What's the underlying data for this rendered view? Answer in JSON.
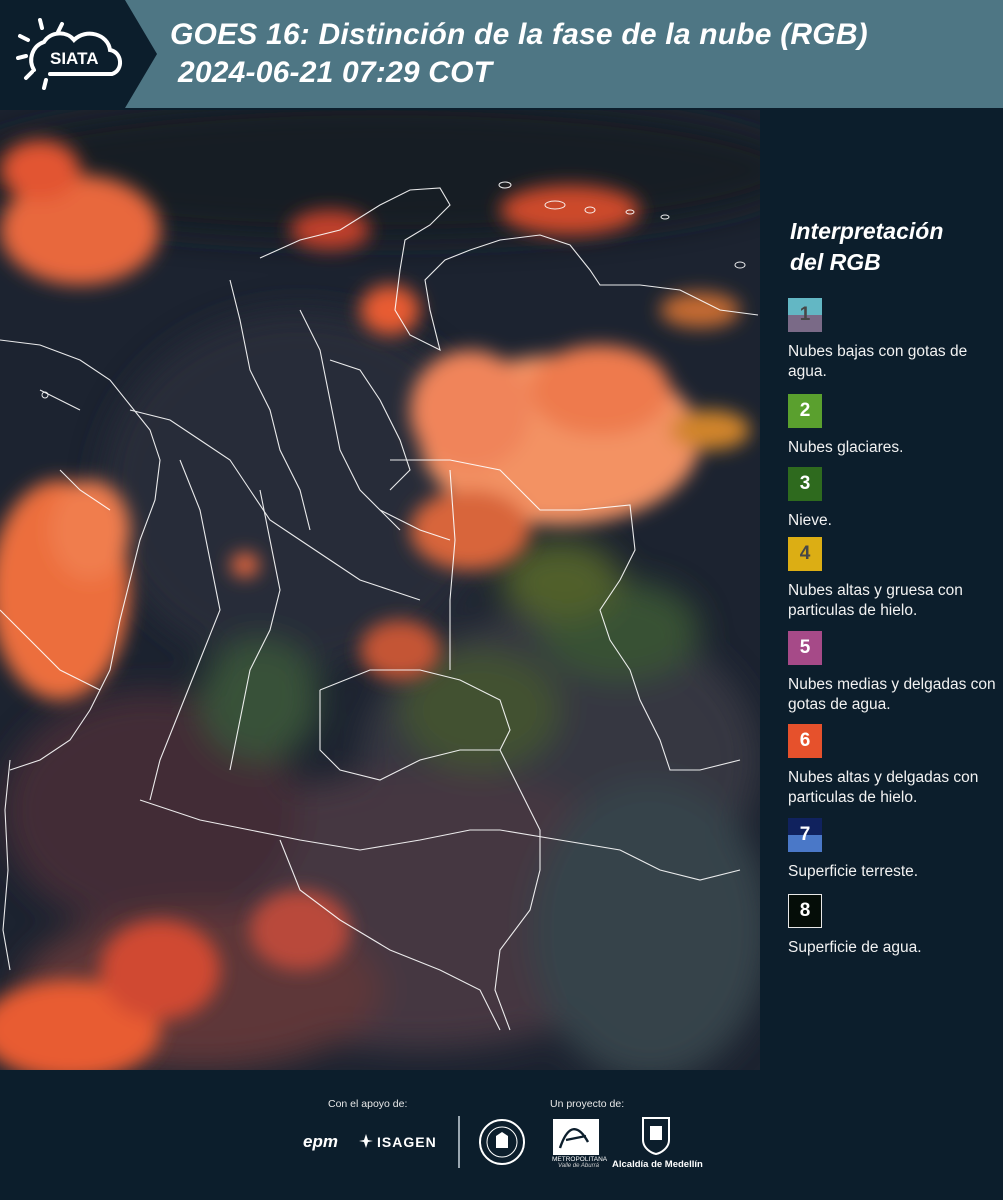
{
  "header": {
    "logo_text": "SIATA",
    "title_line1": "GOES 16: Distinción de la fase de la nube (RGB)",
    "title_line2": "2024-06-21 07:29 COT"
  },
  "legend": {
    "title_line1": "Interpretación",
    "title_line2": "del RGB",
    "items": [
      {
        "num": "1",
        "label": "Nubes bajas con gotas de agua.",
        "color_top": "#63b7c4",
        "color_bottom": "#7a6a87",
        "text_color": "#474747"
      },
      {
        "num": "2",
        "label": "Nubes glaciares.",
        "color_top": "#5aa02e",
        "color_bottom": "#5aa02e",
        "text_color": "#ffffff"
      },
      {
        "num": "3",
        "label": "Nieve.",
        "color_top": "#2e6a1e",
        "color_bottom": "#2e6a1e",
        "text_color": "#ffffff"
      },
      {
        "num": "4",
        "label": "Nubes altas y gruesa con particulas de hielo.",
        "color_top": "#dcae14",
        "color_bottom": "#dcae14",
        "text_color": "#474747"
      },
      {
        "num": "5",
        "label": "Nubes medias y delgadas con gotas de agua.",
        "color_top": "#a64a88",
        "color_bottom": "#a64a88",
        "text_color": "#ffffff"
      },
      {
        "num": "6",
        "label": "Nubes altas y delgadas con particulas de hielo.",
        "color_top": "#e6512c",
        "color_bottom": "#e6512c",
        "text_color": "#ffffff"
      },
      {
        "num": "7",
        "label": "Superficie terreste.",
        "color_top": "#10225e",
        "color_bottom": "#4a78c8",
        "text_color": "#ffffff"
      },
      {
        "num": "8",
        "label": "Superficie de agua.",
        "color_top": "#050d08",
        "color_bottom": "#050d08",
        "text_color": "#ffffff"
      }
    ]
  },
  "footer": {
    "support_label": "Con el apoyo de:",
    "project_label": "Un proyecto de:",
    "sponsor1": "epm",
    "sponsor2": "ISAGEN",
    "metro_text": "METROPOLITANA",
    "metro_sub": "Valle de Aburrá",
    "alcaldia": "Alcaldía de Medellín"
  },
  "icons": [
    "sun-cloud-icon",
    "isagen-icon",
    "university-seal-icon",
    "area-metropolitana-icon",
    "medellin-shield-icon"
  ]
}
